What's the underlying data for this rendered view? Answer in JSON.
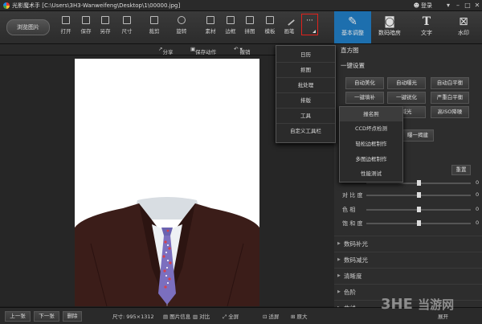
{
  "titlebar": {
    "title": "光影魔术手 [C:\\Users\\3H3-Wanweifeng\\Desktop\\1\\00000.jpg]",
    "login": "登录"
  },
  "toolbar": {
    "browse": "浏览图片",
    "tools": [
      "打开",
      "保存",
      "另存",
      "尺寸",
      "裁剪",
      "旋转",
      "素材",
      "边框",
      "拼图",
      "模板",
      "画笔"
    ],
    "more": "···"
  },
  "right_tabs": [
    "基本调整",
    "数码暗房",
    "文字",
    "水印"
  ],
  "subbar": {
    "share": "分享",
    "save_action": "保存动作",
    "undo": "撤销"
  },
  "more_menu": [
    "日历",
    "抠图",
    "批处理",
    "排版",
    "工具",
    "自定义工具栏"
  ],
  "tools_submenu": [
    "报名照",
    "CCD坏点检测",
    "轻松边框制作",
    "多图边框制作",
    "性能测试"
  ],
  "panel": {
    "histogram": "直方图",
    "oneclick": "一键设置",
    "buttons": [
      "自动美化",
      "自动曝光",
      "自动白平衡",
      "一键填补",
      "一键锐化",
      "严重白平衡",
      "",
      "减光",
      "高ISO降噪"
    ],
    "exposure_btn": "曝一揭建",
    "reset": "重置",
    "adjust": [
      {
        "label": "",
        "value": "0"
      },
      {
        "label": "对 比 度",
        "value": "0"
      },
      {
        "label": "色 相",
        "value": "0"
      },
      {
        "label": "饱 和 度",
        "value": "0"
      }
    ],
    "sections": [
      "数码补光",
      "数码减光",
      "清晰度",
      "色阶",
      "曲线"
    ]
  },
  "bottom": {
    "prev": "上一张",
    "next": "下一张",
    "delete": "删除",
    "size": "尺寸: 995×1312",
    "info": "图片信息",
    "compare": "对比",
    "fullscreen": "全屏",
    "fit": "适屏",
    "zoom": "原大",
    "expand": "展开"
  },
  "watermark": {
    "brand": "3HE",
    "suffix": "当游网"
  },
  "colors": {
    "accent": "#1d6fae",
    "highlight": "#e0221c",
    "suit": "#3a1c18"
  }
}
